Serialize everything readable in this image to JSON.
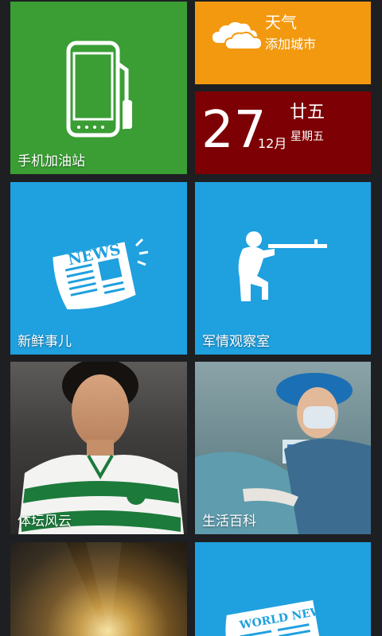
{
  "tiles": {
    "gas_station": {
      "label": "手机加油站",
      "color": "#3a9e34"
    },
    "weather": {
      "title": "天气",
      "subtitle": "添加城市",
      "color": "#f3990f"
    },
    "calendar": {
      "day": "27",
      "lunar": "廿五",
      "month": "12月",
      "weekday": "星期五",
      "color": "#7d0004"
    },
    "news": {
      "label": "新鲜事儿",
      "icon_text": "NEWS",
      "color": "#1fa0df"
    },
    "military": {
      "label": "军情观察室",
      "color": "#1fa0df"
    },
    "sports": {
      "label": "体坛风云"
    },
    "life": {
      "label": "生活百科"
    },
    "world_news": {
      "icon_text": "WORLD NEWS",
      "color": "#1fa0df"
    }
  }
}
